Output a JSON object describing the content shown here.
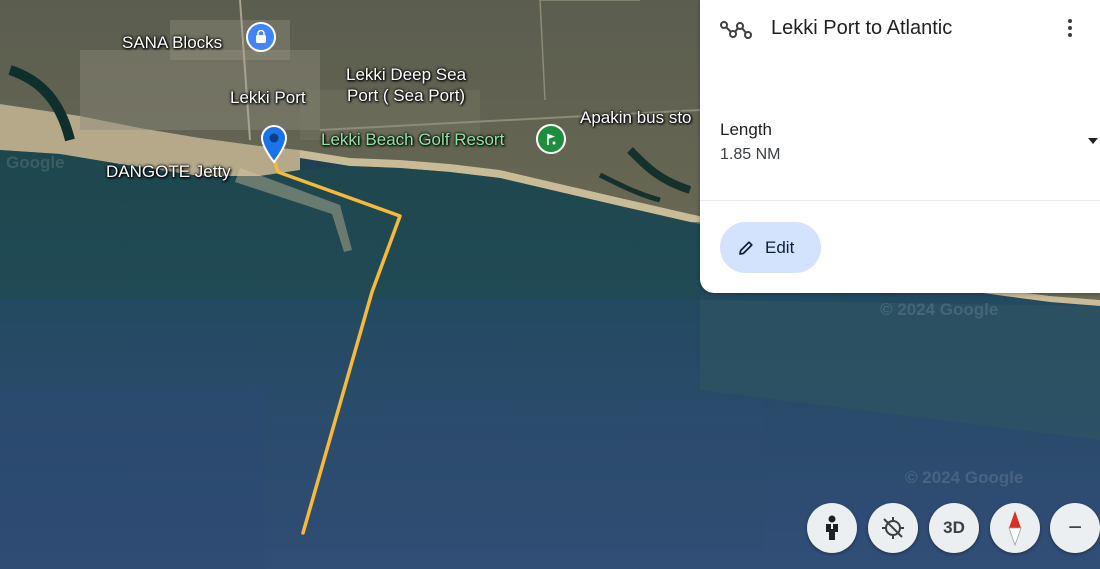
{
  "map": {
    "labels": {
      "sana_blocks": "SANA Blocks",
      "lekki_port": "Lekki Port",
      "lekki_deep_sea_1": "Lekki Deep Sea",
      "lekki_deep_sea_2": "Port ( Sea Port)",
      "apakin": "Apakin bus sto",
      "golf_resort": "Lekki Beach Golf Resort",
      "dangote_jetty": "DANGOTE Jetty"
    },
    "watermarks": {
      "google": "Google",
      "copyright": "© 2024 Google"
    },
    "route_color": "#f6b93b"
  },
  "panel": {
    "title": "Lekki Port to Atlantic",
    "length_label": "Length",
    "length_value": "1.85 NM",
    "edit_label": "Edit"
  },
  "controls": {
    "three_d_label": "3D",
    "zoom_out_label": "−"
  },
  "icons": {
    "route": "route-icon",
    "more": "more-vert-icon",
    "dropdown": "dropdown-arrow-icon",
    "edit": "pencil-icon",
    "pegman": "pegman-icon",
    "location": "location-off-icon",
    "compass": "compass-icon",
    "shop": "shopping-bag-icon",
    "golf": "golf-icon"
  }
}
